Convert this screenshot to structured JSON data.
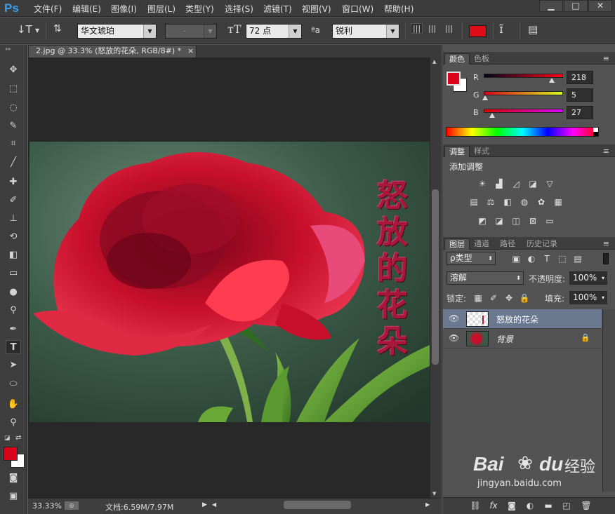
{
  "app": {
    "logo": "Ps",
    "menu": [
      "文件(F)",
      "编辑(E)",
      "图像(I)",
      "图层(L)",
      "类型(Y)",
      "选择(S)",
      "滤镜(T)",
      "视图(V)",
      "窗口(W)",
      "帮助(H)"
    ],
    "window_controls": {
      "minimize": "▁",
      "restore": "□",
      "close": "✕"
    }
  },
  "options": {
    "tool_glyph": "↓T",
    "font_family": "华文琥珀",
    "font_style": "-",
    "font_size": "72 点",
    "aa_label": "ªa",
    "anti_alias": "锐利",
    "text_color": "#e00c18"
  },
  "document": {
    "tab_title": "2.jpg @ 33.3% (怒放的花朵, RGB/8#) *",
    "tab_close": "×",
    "overlay_text": [
      "怒",
      "放",
      "的",
      "花",
      "朵"
    ],
    "overlay_color": "#a8183c",
    "zoom": "33.33%",
    "doc_info": "文档:6.59M/7.97M"
  },
  "color_panel": {
    "tabs": [
      "颜色",
      "色板"
    ],
    "foreground": "#da051b",
    "background": "#ffffff",
    "channels": [
      {
        "label": "R",
        "value": "218",
        "fraction": 0.855
      },
      {
        "label": "G",
        "value": "5",
        "fraction": 0.02
      },
      {
        "label": "B",
        "value": "27",
        "fraction": 0.106
      }
    ]
  },
  "adjust_panel": {
    "tabs": [
      "调整",
      "样式"
    ],
    "title": "添加调整",
    "icons_row1": [
      "brightness-icon",
      "levels-icon",
      "curves-icon",
      "exposure-icon",
      "gradient-triangle-icon"
    ],
    "icons_row2": [
      "vibrance-icon",
      "color-balance-icon",
      "black-white-icon",
      "photo-filter-icon",
      "channel-mixer-icon",
      "color-lookup-icon"
    ],
    "icons_row3": [
      "invert-icon",
      "posterize-icon",
      "threshold-icon",
      "selective-color-icon",
      "gradient-map-icon"
    ]
  },
  "layers_panel": {
    "tabs": [
      "图层",
      "通道",
      "路径",
      "历史记录"
    ],
    "filter_label": "ρ类型",
    "blend_mode": "溶解",
    "opacity_label": "不透明度:",
    "opacity": "100%",
    "lock_label": "锁定:",
    "fill_label": "填充:",
    "fill": "100%",
    "layers": [
      {
        "name": "怒放的花朵",
        "selected": true,
        "locked": false
      },
      {
        "name": "背景",
        "selected": false,
        "locked": true
      }
    ]
  },
  "watermark": {
    "brand": "Bai",
    "brand2": "du",
    "cn": "经验",
    "url": "jingyan.baidu.com"
  }
}
